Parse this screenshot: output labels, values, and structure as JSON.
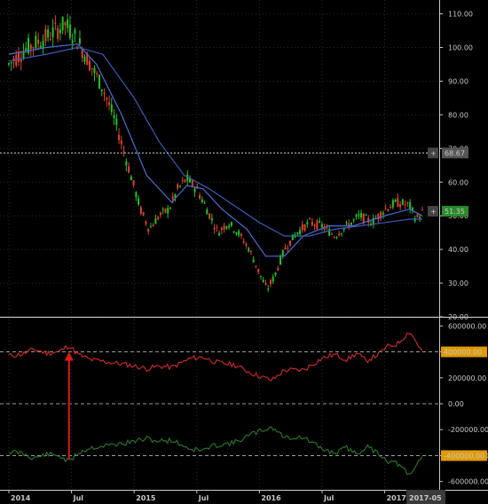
{
  "chart_data": [
    {
      "type": "candlestick",
      "title": "",
      "x_ticks": [
        "2014",
        "Jul",
        "2015",
        "Jul",
        "2016",
        "Jul",
        "2017",
        "2017-05"
      ],
      "y_ticks": [
        "110.00",
        "100.00",
        "90.00",
        "80.00",
        "70.00",
        "60.00",
        "50.00",
        "40.00",
        "30.00",
        "20.00"
      ],
      "ylim": [
        20,
        112
      ],
      "price_points": [
        [
          2014.0,
          95
        ],
        [
          2014.15,
          100
        ],
        [
          2014.3,
          103
        ],
        [
          2014.45,
          107
        ],
        [
          2014.55,
          102
        ],
        [
          2014.65,
          95
        ],
        [
          2014.75,
          88
        ],
        [
          2014.85,
          78
        ],
        [
          2014.95,
          65
        ],
        [
          2015.05,
          52
        ],
        [
          2015.12,
          46
        ],
        [
          2015.2,
          50
        ],
        [
          2015.28,
          52
        ],
        [
          2015.35,
          58
        ],
        [
          2015.42,
          61
        ],
        [
          2015.5,
          58
        ],
        [
          2015.58,
          52
        ],
        [
          2015.67,
          45
        ],
        [
          2015.75,
          48
        ],
        [
          2015.83,
          45
        ],
        [
          2015.92,
          40
        ],
        [
          2016.0,
          33
        ],
        [
          2016.06,
          28
        ],
        [
          2016.12,
          32
        ],
        [
          2016.2,
          40
        ],
        [
          2016.3,
          45
        ],
        [
          2016.4,
          48
        ],
        [
          2016.5,
          47
        ],
        [
          2016.6,
          44
        ],
        [
          2016.7,
          47
        ],
        [
          2016.8,
          50
        ],
        [
          2016.9,
          48
        ],
        [
          2017.0,
          52
        ],
        [
          2017.1,
          54
        ],
        [
          2017.2,
          53
        ],
        [
          2017.25,
          49
        ],
        [
          2017.3,
          51
        ]
      ],
      "moving_averages": [
        {
          "name": "fast",
          "color": "#4a6fd4",
          "points": [
            [
              2014.0,
              98
            ],
            [
              2014.3,
              100
            ],
            [
              2014.55,
              101
            ],
            [
              2014.7,
              95
            ],
            [
              2014.9,
              80
            ],
            [
              2015.1,
              62
            ],
            [
              2015.3,
              54
            ],
            [
              2015.42,
              59
            ],
            [
              2015.55,
              58
            ],
            [
              2015.7,
              52
            ],
            [
              2015.9,
              46
            ],
            [
              2016.05,
              38
            ],
            [
              2016.2,
              38
            ],
            [
              2016.35,
              44
            ],
            [
              2016.55,
              47
            ],
            [
              2016.75,
              47
            ],
            [
              2017.0,
              50
            ],
            [
              2017.2,
              52
            ],
            [
              2017.3,
              50
            ]
          ]
        },
        {
          "name": "slow",
          "color": "#3a5cb8",
          "points": [
            [
              2014.0,
              96
            ],
            [
              2014.3,
              98
            ],
            [
              2014.55,
              100
            ],
            [
              2014.75,
              98
            ],
            [
              2015.0,
              85
            ],
            [
              2015.2,
              72
            ],
            [
              2015.4,
              62
            ],
            [
              2015.6,
              58
            ],
            [
              2015.8,
              53
            ],
            [
              2016.0,
              48
            ],
            [
              2016.2,
              44
            ],
            [
              2016.4,
              44
            ],
            [
              2016.6,
              46
            ],
            [
              2016.8,
              47
            ],
            [
              2017.0,
              48
            ],
            [
              2017.2,
              49
            ],
            [
              2017.3,
              49
            ]
          ]
        }
      ],
      "price_markers": [
        {
          "label": "68.67",
          "value": 68.67,
          "color": "#555555",
          "line_color": "#cccccc"
        },
        {
          "label": "51.35",
          "value": 51.35,
          "color": "#2a8a2a",
          "line_color": null
        }
      ]
    },
    {
      "type": "line",
      "title": "",
      "y_ticks": [
        "600000.00",
        "400000.00",
        "200000.00",
        "0.00",
        "-200000.00",
        "-400000.00",
        "-600000.00"
      ],
      "ylim": [
        -650000,
        650000
      ],
      "dashed_levels": [
        400000,
        0,
        -400000
      ],
      "highlight_labels": [
        {
          "label": "400000.00",
          "value": 400000,
          "color": "#e09a00"
        },
        {
          "label": "-400000.00",
          "value": -400000,
          "color": "#e09a00"
        }
      ],
      "series": [
        {
          "name": "",
          "color": "#d42a2a",
          "points": [
            [
              2014.0,
              370000
            ],
            [
              2014.1,
              380000
            ],
            [
              2014.2,
              420000
            ],
            [
              2014.3,
              390000
            ],
            [
              2014.4,
              400000
            ],
            [
              2014.48,
              450000
            ],
            [
              2014.55,
              380000
            ],
            [
              2014.65,
              340000
            ],
            [
              2014.8,
              320000
            ],
            [
              2014.95,
              300000
            ],
            [
              2015.1,
              270000
            ],
            [
              2015.2,
              290000
            ],
            [
              2015.3,
              280000
            ],
            [
              2015.45,
              350000
            ],
            [
              2015.55,
              360000
            ],
            [
              2015.65,
              320000
            ],
            [
              2015.8,
              300000
            ],
            [
              2015.95,
              230000
            ],
            [
              2016.1,
              180000
            ],
            [
              2016.2,
              260000
            ],
            [
              2016.35,
              260000
            ],
            [
              2016.5,
              350000
            ],
            [
              2016.6,
              380000
            ],
            [
              2016.7,
              340000
            ],
            [
              2016.78,
              390000
            ],
            [
              2016.85,
              330000
            ],
            [
              2016.95,
              380000
            ],
            [
              2017.02,
              440000
            ],
            [
              2017.1,
              460000
            ],
            [
              2017.15,
              510000
            ],
            [
              2017.2,
              560000
            ],
            [
              2017.25,
              480000
            ],
            [
              2017.3,
              400000
            ]
          ]
        },
        {
          "name": "",
          "color": "#2a7a2a",
          "points": [
            [
              2014.0,
              -370000
            ],
            [
              2014.1,
              -380000
            ],
            [
              2014.2,
              -420000
            ],
            [
              2014.3,
              -390000
            ],
            [
              2014.4,
              -400000
            ],
            [
              2014.48,
              -450000
            ],
            [
              2014.55,
              -380000
            ],
            [
              2014.65,
              -340000
            ],
            [
              2014.8,
              -320000
            ],
            [
              2014.95,
              -300000
            ],
            [
              2015.1,
              -270000
            ],
            [
              2015.2,
              -290000
            ],
            [
              2015.3,
              -280000
            ],
            [
              2015.45,
              -350000
            ],
            [
              2015.55,
              -360000
            ],
            [
              2015.65,
              -320000
            ],
            [
              2015.8,
              -300000
            ],
            [
              2015.95,
              -230000
            ],
            [
              2016.1,
              -180000
            ],
            [
              2016.2,
              -260000
            ],
            [
              2016.35,
              -260000
            ],
            [
              2016.5,
              -350000
            ],
            [
              2016.6,
              -380000
            ],
            [
              2016.7,
              -340000
            ],
            [
              2016.78,
              -390000
            ],
            [
              2016.85,
              -330000
            ],
            [
              2016.95,
              -380000
            ],
            [
              2017.02,
              -440000
            ],
            [
              2017.1,
              -460000
            ],
            [
              2017.15,
              -510000
            ],
            [
              2017.2,
              -560000
            ],
            [
              2017.25,
              -480000
            ],
            [
              2017.3,
              -400000
            ]
          ]
        }
      ],
      "annotations": [
        {
          "type": "arrow",
          "color": "#e01818",
          "x": 2014.48,
          "y_from": -430000,
          "y_to": 400000
        }
      ]
    }
  ]
}
